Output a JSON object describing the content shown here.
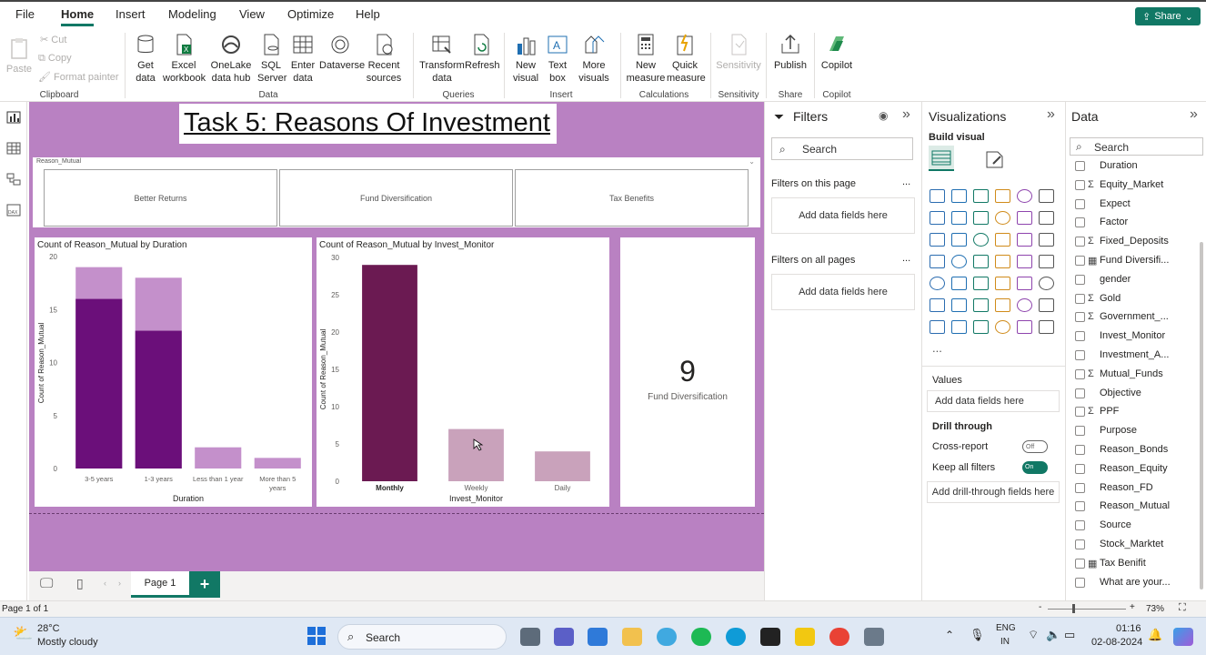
{
  "menu": {
    "items": [
      "File",
      "Home",
      "Insert",
      "Modeling",
      "View",
      "Optimize",
      "Help"
    ],
    "active": "Home",
    "share": "Share"
  },
  "ribbon": {
    "clipboard": {
      "paste": "Paste",
      "cut": "Cut",
      "copy": "Copy",
      "format_painter": "Format painter",
      "group": "Clipboard"
    },
    "data": {
      "get_data": "Get data",
      "excel": "Excel workbook",
      "onelake": "OneLake data hub",
      "sql": "SQL Server",
      "enter": "Enter data",
      "dataverse": "Dataverse",
      "recent": "Recent sources",
      "group": "Data"
    },
    "queries": {
      "transform": "Transform data",
      "refresh": "Refresh",
      "group": "Queries"
    },
    "insert": {
      "new_visual": "New visual",
      "text_box": "Text box",
      "more_visuals": "More visuals",
      "group": "Insert"
    },
    "calculations": {
      "new_measure": "New measure",
      "quick_measure": "Quick measure",
      "group": "Calculations"
    },
    "sensitivity": {
      "label": "Sensitivity",
      "group": "Sensitivity"
    },
    "share": {
      "publish": "Publish",
      "group": "Share"
    },
    "copilot": {
      "label": "Copilot",
      "group": "Copilot"
    }
  },
  "report": {
    "title": "Task 5: Reasons Of Investment",
    "slicer": {
      "label": "Reason_Mutual",
      "options": [
        "Better Returns",
        "Fund Diversification",
        "Tax Benefits"
      ]
    },
    "card": {
      "value": "9",
      "label": "Fund Diversification"
    }
  },
  "chart_data": [
    {
      "type": "bar",
      "title": "Count of Reason_Mutual by Duration",
      "xlabel": "Duration",
      "ylabel": "Count of Reason_Mutual",
      "categories": [
        "3-5 years",
        "1-3 years",
        "Less than 1 year",
        "More than 5 years"
      ],
      "series": [
        {
          "values": [
            16,
            13,
            0,
            0
          ]
        },
        {
          "values": [
            19,
            18,
            2,
            1
          ]
        }
      ],
      "ylim": [
        0,
        20
      ],
      "yticks": [
        0,
        5,
        10,
        15,
        20
      ],
      "colors": [
        "#6b0f7a",
        "#c490cb"
      ]
    },
    {
      "type": "bar",
      "title": "Count of Reason_Mutual by Invest_Monitor",
      "xlabel": "Invest_Monitor",
      "ylabel": "Count of Reason_Mutual",
      "categories": [
        "Monthly",
        "Weekly",
        "Daily"
      ],
      "values": [
        29,
        7,
        4
      ],
      "ylim": [
        0,
        30
      ],
      "yticks": [
        0,
        5,
        10,
        15,
        20,
        25,
        30
      ],
      "colors": [
        "#6b1a52",
        "#c9a2bb",
        "#c9a2bb"
      ]
    }
  ],
  "pages": {
    "tab": "Page 1",
    "status": "Page 1 of 1",
    "zoom": "73%"
  },
  "filters": {
    "title": "Filters",
    "search": "Search",
    "on_page": "Filters on this page",
    "on_all": "Filters on all pages",
    "add_fields": "Add data fields here",
    "more": "..."
  },
  "visualizations": {
    "title": "Visualizations",
    "build": "Build visual",
    "values": "Values",
    "add_fields": "Add data fields here",
    "drill": "Drill through",
    "cross_report": "Cross-report",
    "cross_state": "Off",
    "keep_filters": "Keep all filters",
    "keep_state": "On",
    "add_drill": "Add drill-through fields here",
    "more": "..."
  },
  "data_pane": {
    "title": "Data",
    "search": "Search",
    "fields": [
      {
        "name": "Duration",
        "icon": ""
      },
      {
        "name": "Equity_Market",
        "icon": "Σ"
      },
      {
        "name": "Expect",
        "icon": ""
      },
      {
        "name": "Factor",
        "icon": ""
      },
      {
        "name": "Fixed_Deposits",
        "icon": "Σ"
      },
      {
        "name": "Fund Diversifi...",
        "icon": "▦"
      },
      {
        "name": "gender",
        "icon": ""
      },
      {
        "name": "Gold",
        "icon": "Σ"
      },
      {
        "name": "Government_...",
        "icon": "Σ"
      },
      {
        "name": "Invest_Monitor",
        "icon": ""
      },
      {
        "name": "Investment_A...",
        "icon": ""
      },
      {
        "name": "Mutual_Funds",
        "icon": "Σ"
      },
      {
        "name": "Objective",
        "icon": ""
      },
      {
        "name": "PPF",
        "icon": "Σ"
      },
      {
        "name": "Purpose",
        "icon": ""
      },
      {
        "name": "Reason_Bonds",
        "icon": ""
      },
      {
        "name": "Reason_Equity",
        "icon": ""
      },
      {
        "name": "Reason_FD",
        "icon": ""
      },
      {
        "name": "Reason_Mutual",
        "icon": ""
      },
      {
        "name": "Source",
        "icon": ""
      },
      {
        "name": "Stock_Marktet",
        "icon": ""
      },
      {
        "name": "Tax Benifit",
        "icon": "▦"
      },
      {
        "name": "What are your...",
        "icon": ""
      }
    ]
  },
  "taskbar": {
    "temp": "28°C",
    "weather": "Mostly cloudy",
    "search": "Search",
    "lang1": "ENG",
    "lang2": "IN",
    "time": "01:16",
    "date": "02-08-2024"
  }
}
